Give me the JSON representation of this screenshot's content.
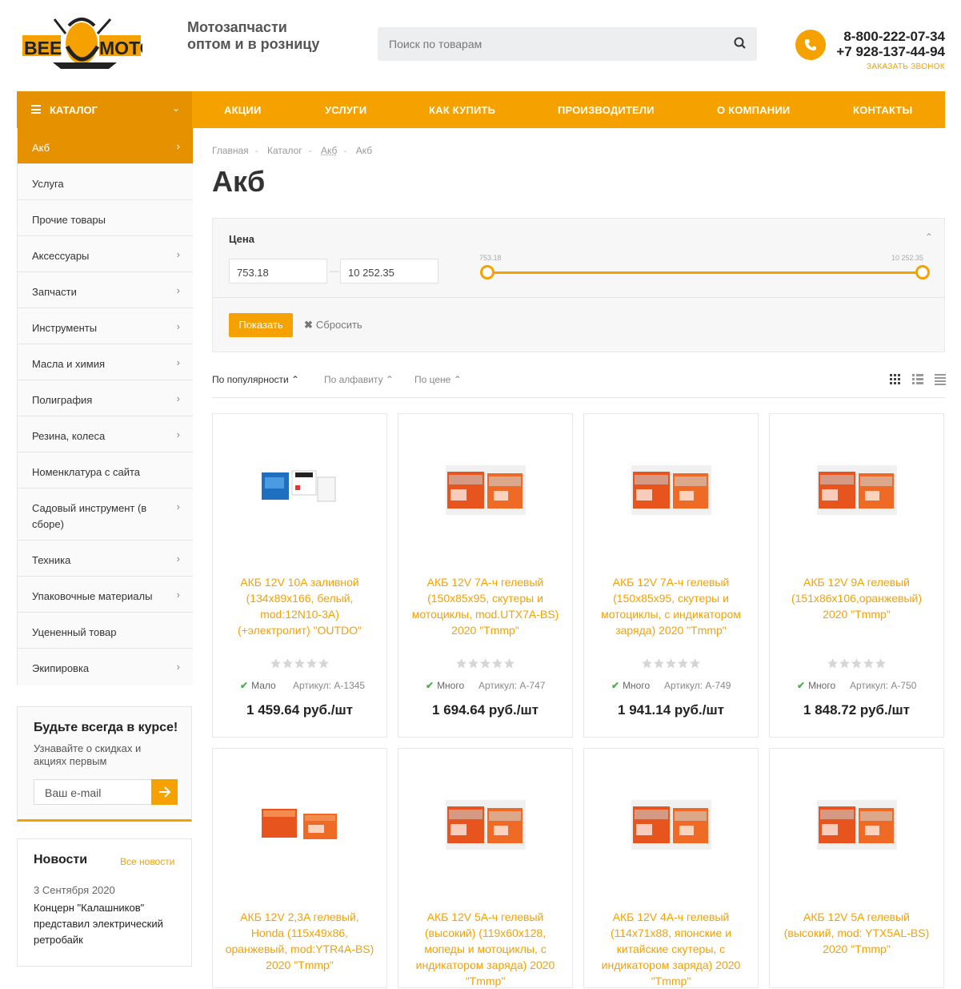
{
  "header": {
    "logo_text": "BEE MOTO",
    "tagline_line1": "Мотозапчасти",
    "tagline_line2": "оптом и в розницу",
    "search_placeholder": "Поиск по товарам",
    "phone1": "8-800-222-07-34",
    "phone2": "+7 928-137-44-94",
    "callback": "ЗАКАЗАТЬ ЗВОНОК"
  },
  "nav": {
    "catalog": "КАТАЛОГ",
    "items": [
      "АКЦИИ",
      "УСЛУГИ",
      "КАК КУПИТЬ",
      "ПРОИЗВОДИТЕЛИ",
      "О КОМПАНИИ",
      "КОНТАКТЫ"
    ]
  },
  "sidebar": {
    "items": [
      {
        "label": "Акб",
        "arrow": true,
        "active": true
      },
      {
        "label": "Услуга",
        "arrow": false
      },
      {
        "label": "Прочие товары",
        "arrow": false
      },
      {
        "label": "Аксессуары",
        "arrow": true
      },
      {
        "label": "Запчасти",
        "arrow": true
      },
      {
        "label": "Инструменты",
        "arrow": true
      },
      {
        "label": "Масла и химия",
        "arrow": true
      },
      {
        "label": "Полиграфия",
        "arrow": true
      },
      {
        "label": "Резина, колеса",
        "arrow": true
      },
      {
        "label": "Номенклатура с сайта",
        "arrow": false
      },
      {
        "label": "Садовый инструмент (в сборе)",
        "arrow": true
      },
      {
        "label": "Техника",
        "arrow": true
      },
      {
        "label": "Упаковочные материалы",
        "arrow": true
      },
      {
        "label": "Уцененный товар",
        "arrow": false
      },
      {
        "label": "Экипировка",
        "arrow": true
      }
    ]
  },
  "subscribe": {
    "title": "Будьте всегда в курсе!",
    "text": "Узнавайте о скидках и акциях первым",
    "placeholder": "Ваш e-mail"
  },
  "news": {
    "title": "Новости",
    "all_link": "Все новости",
    "date": "3 Сентября 2020",
    "text": "Концерн \"Калашников\" представил электрический ретробайк"
  },
  "breadcrumb": [
    "Главная",
    "Каталог",
    "Акб",
    "Акб"
  ],
  "page_title": "Акб",
  "filter": {
    "title": "Цена",
    "min_value": "753.18",
    "max_value": "10 252.35",
    "slider_min_label": "753.18",
    "slider_max_label": "10 252.35",
    "show_button": "Показать",
    "reset_button": "Сбросить"
  },
  "sort": {
    "options": [
      "По популярности",
      "По алфавиту",
      "По цене"
    ]
  },
  "products": [
    {
      "name": "АКБ 12V 10A заливной (134x89x166, белый, mod:12N10-3A) (+электролит) \"OUTDO\"",
      "stock": "Мало",
      "sku": "Артикул: A-1345",
      "price": "1 459.64 руб./шт",
      "img": "battery-blue-icon"
    },
    {
      "name": "АКБ 12V 7А-ч гелевый (150x85x95, скутеры и мотоциклы, mod.UTX7A-BS) 2020 \"Tmmp\"",
      "stock": "Много",
      "sku": "Артикул: A-747",
      "price": "1 694.64 руб./шт",
      "img": "battery-orange-icon"
    },
    {
      "name": "АКБ 12V 7А-ч гелевый (150x85x95, скутеры и мотоциклы, с индикатором заряда) 2020 \"Tmmp\"",
      "stock": "Много",
      "sku": "Артикул: A-749",
      "price": "1 941.14 руб./шт",
      "img": "battery-orange-icon"
    },
    {
      "name": "АКБ 12V 9A гелевый (151x86x106,оранжевый) 2020 \"Tmmp\"",
      "stock": "Много",
      "sku": "Артикул: A-750",
      "price": "1 848.72 руб./шт",
      "img": "battery-orange-icon"
    },
    {
      "name": "АКБ 12V 2,3A гелевый, Honda (115x49x86, оранжевый, mod:YTR4A-BS) 2020 \"Tmmp\"",
      "stock": "",
      "sku": "",
      "price": "",
      "img": "battery-small-icon"
    },
    {
      "name": "АКБ 12V 5А-ч гелевый (высокий) (119x60x128, мопеды и мотоциклы, с индикатором заряда) 2020 \"Tmmp\"",
      "stock": "",
      "sku": "",
      "price": "",
      "img": "battery-orange-icon"
    },
    {
      "name": "АКБ 12V 4А-ч гелевый (114x71x88, японские и китайские скутеры, с индикатором заряда) 2020 \"Tmmp\"",
      "stock": "",
      "sku": "",
      "price": "",
      "img": "battery-orange-icon"
    },
    {
      "name": "АКБ 12V 5A гелевый (высокий, mod: YTX5AL-BS) 2020 \"Tmmp\"",
      "stock": "",
      "sku": "",
      "price": "",
      "img": "battery-orange-icon"
    }
  ],
  "colors": {
    "accent": "#f5a100",
    "accent_dark": "#e69100"
  }
}
